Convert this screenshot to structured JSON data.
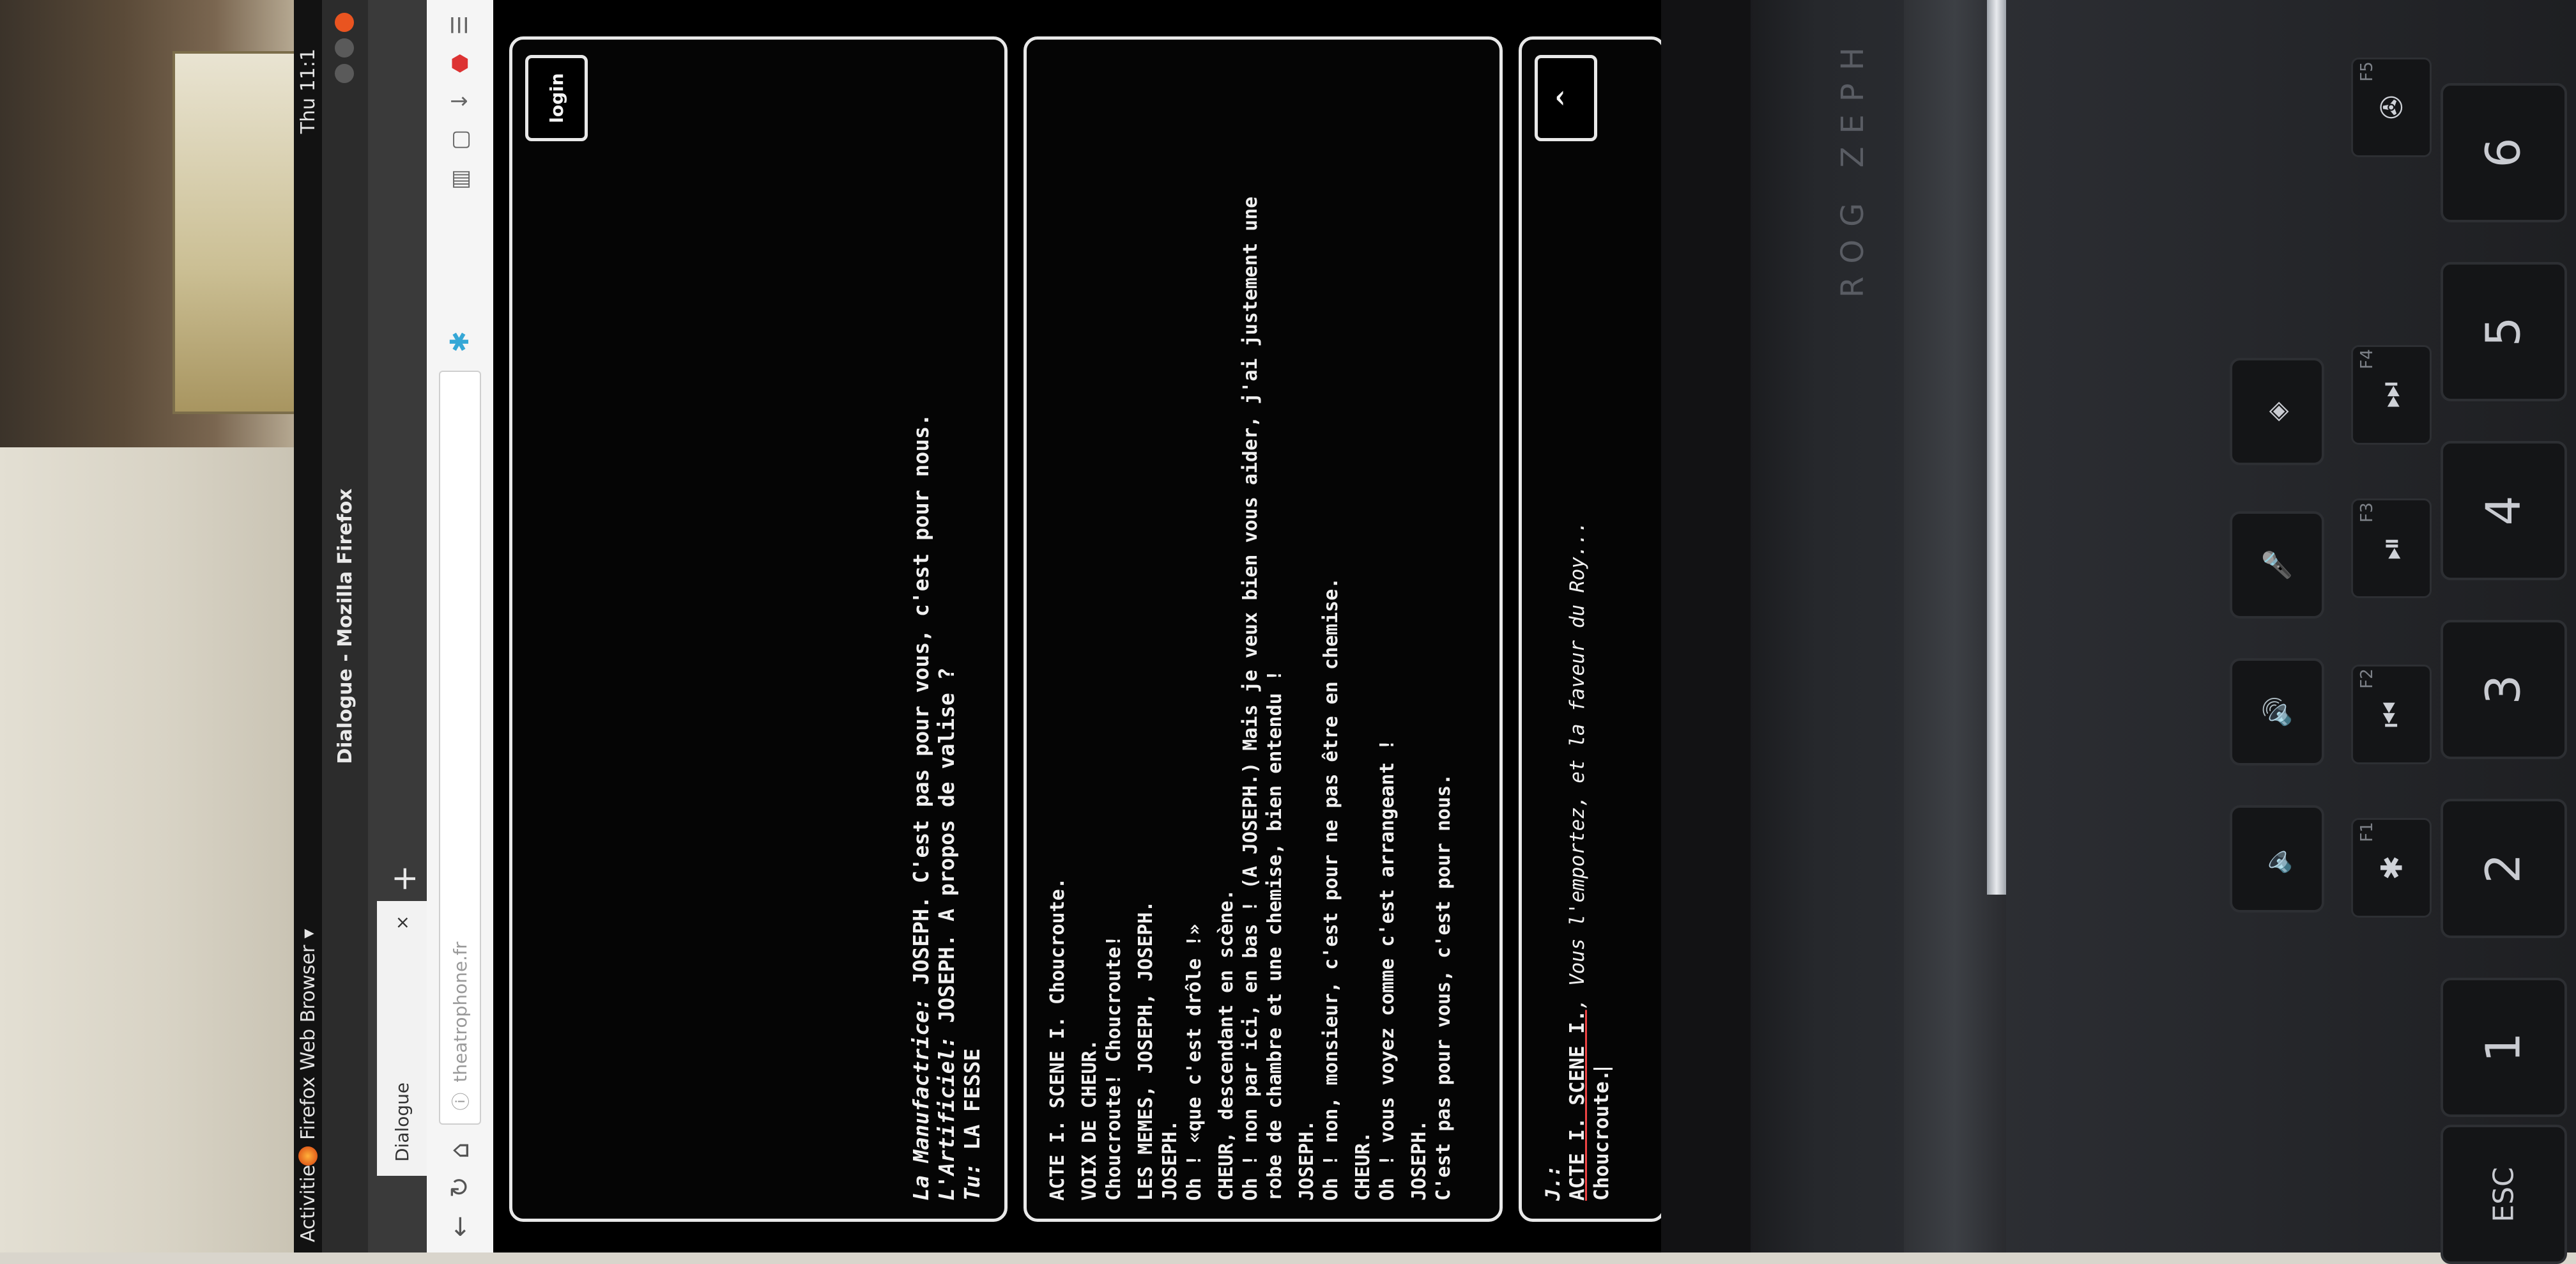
{
  "desktop": {
    "activities": "Activities",
    "app_menu": "Firefox Web Browser",
    "clock": "Thu 11:1"
  },
  "window": {
    "title": "Dialogue - Mozilla Firefox"
  },
  "tabs": [
    {
      "label": "Dialogue"
    }
  ],
  "navbar": {
    "url": "theatrophone.fr"
  },
  "chat": {
    "login_label": "login",
    "lines": [
      {
        "who": "La Manufactrice:",
        "text": "JOSEPH. C'est pas pour vous, c'est pour nous."
      },
      {
        "who": "L'Artificiel:",
        "text": "JOSEPH. A propos de valise ?"
      },
      {
        "who": "Tu:",
        "text": "LA FESSE"
      }
    ]
  },
  "script": {
    "lines": [
      "ACTE I. SCENE I. Choucroute.",
      "",
      "VOIX DE CHEUR.",
      "Choucroute! Choucroute!",
      "",
      "LES MEMES, JOSEPH, JOSEPH.",
      "JOSEPH.",
      "Oh ! «que c'est drôle !»",
      "",
      "CHEUR, descendant en scène.",
      "Oh ! non par ici, en bas ! (A JOSEPH.) Mais je veux bien vous aider, j'ai justement une",
      "robe de chambre et une chemise, bien entendu !",
      "",
      "JOSEPH.",
      "Oh ! non, monsieur, c'est pour ne pas être en chemise.",
      "",
      "CHEUR.",
      "Oh ! vous voyez comme c'est arrangeant !",
      "",
      "JOSEPH.",
      "C'est pas pour vous, c'est pour nous."
    ]
  },
  "input": {
    "prompt": "J.:",
    "ref": "ACTE I. SCENE I.",
    "text": ", Vous l'emportez, et la faveur du Roy...",
    "line2": "Choucroute.",
    "collapse_label": "^"
  },
  "laptop": {
    "brand": "ROG ZEPH",
    "keys": [
      "ESC",
      "1",
      "2",
      "3",
      "4",
      "5",
      "6"
    ],
    "key_shifts": [
      "!",
      "\"",
      "£",
      "$",
      "%",
      "^"
    ],
    "fkeys": [
      "F1",
      "F2",
      "F3",
      "F4",
      "F5"
    ]
  }
}
